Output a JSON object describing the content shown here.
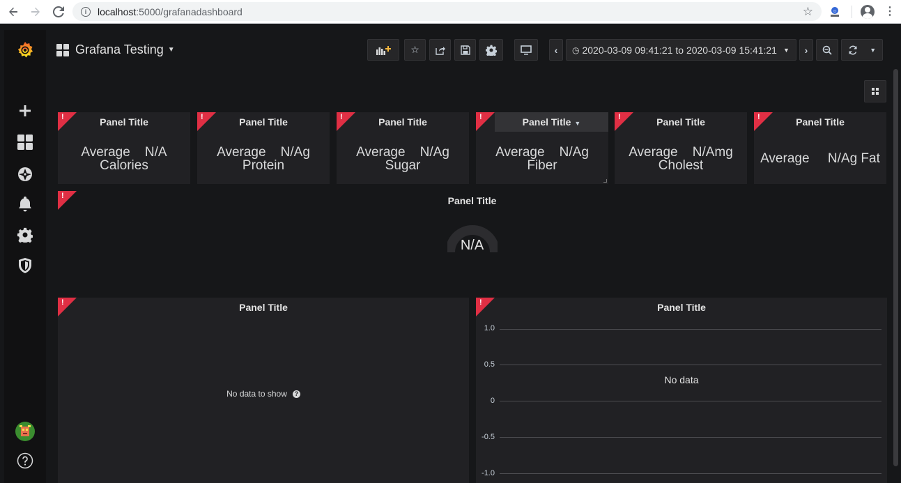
{
  "browser": {
    "url_host": "localhost",
    "url_path": ":5000/grafanadashboard"
  },
  "dashboard": {
    "title": "Grafana Testing",
    "time_range": "2020-03-09 09:41:21 to 2020-03-09 15:41:21"
  },
  "stat_panels": [
    {
      "title": "Panel Title",
      "line1": "Average    N/A",
      "line2": "Calories"
    },
    {
      "title": "Panel Title",
      "line1": "Average    N/Ag",
      "line2": "Protein"
    },
    {
      "title": "Panel Title",
      "line1": "Average    N/Ag",
      "line2": "Sugar"
    },
    {
      "title": "Panel Title",
      "line1": "Average    N/Ag",
      "line2": "Fiber"
    },
    {
      "title": "Panel Title",
      "line1": "Average    N/Amg",
      "line2": "Cholest"
    },
    {
      "title": "Panel Title",
      "line1": "Average     N/Ag Fat",
      "line2": ""
    }
  ],
  "gauge_panel": {
    "title": "Panel Title",
    "value": "N/A"
  },
  "table_panel": {
    "title": "Panel Title",
    "no_data": "No data to show"
  },
  "graph_panel": {
    "title": "Panel Title",
    "no_data": "No data",
    "y_ticks": [
      "1.0",
      "0.5",
      "0",
      "-0.5",
      "-1.0"
    ]
  },
  "colors": {
    "error_corner": "#e02f44",
    "panel_bg": "#212124",
    "page_bg": "#161719",
    "sidemenu_bg": "#111112"
  }
}
